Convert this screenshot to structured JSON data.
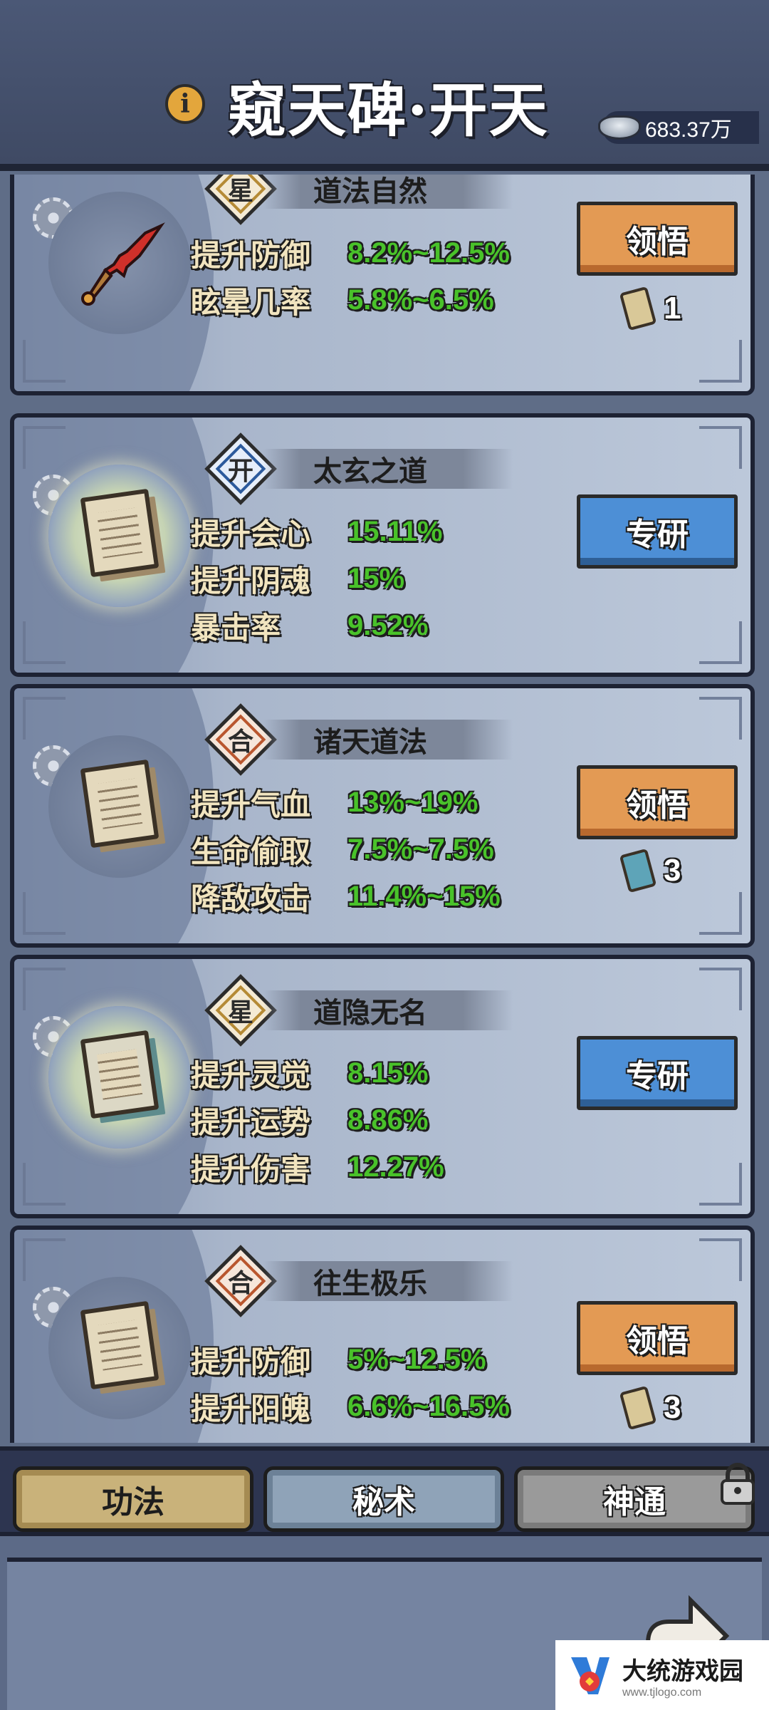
{
  "header": {
    "title": "窥天碑·开天",
    "info_icon": "i",
    "currency_value": "683.37万"
  },
  "skills": [
    {
      "grade": "星",
      "name": "道法自然",
      "icon": "red-sword-icon",
      "stats": [
        {
          "label": "提升防御",
          "value": "8.2%~12.5%"
        },
        {
          "label": "眩晕几率",
          "value": "5.8%~6.5%"
        }
      ],
      "action": "领悟",
      "action_color": "#e39a54",
      "cost_count": "1"
    },
    {
      "grade": "开",
      "name": "太玄之道",
      "icon": "scroll-icon",
      "stats": [
        {
          "label": "提升会心",
          "value": "15.11%"
        },
        {
          "label": "提升阴魂",
          "value": "15%"
        },
        {
          "label": "暴击率",
          "value": "9.52%"
        }
      ],
      "action": "专研",
      "action_color": "#4d8fd6"
    },
    {
      "grade": "合",
      "name": "诸天道法",
      "icon": "scroll-icon",
      "stats": [
        {
          "label": "提升气血",
          "value": "13%~19%"
        },
        {
          "label": "生命偷取",
          "value": "7.5%~7.5%"
        },
        {
          "label": "降敌攻击",
          "value": "11.4%~15%"
        }
      ],
      "action": "领悟",
      "action_color": "#e39a54",
      "cost_count": "3"
    },
    {
      "grade": "星",
      "name": "道隐无名",
      "icon": "scroll-icon",
      "stats": [
        {
          "label": "提升灵觉",
          "value": "8.15%"
        },
        {
          "label": "提升运势",
          "value": "8.86%"
        },
        {
          "label": "提升伤害",
          "value": "12.27%"
        }
      ],
      "action": "专研",
      "action_color": "#4d8fd6"
    },
    {
      "grade": "合",
      "name": "往生极乐",
      "icon": "scroll-icon",
      "stats": [
        {
          "label": "提升防御",
          "value": "5%~12.5%"
        },
        {
          "label": "提升阳魄",
          "value": "6.6%~16.5%"
        }
      ],
      "action": "领悟",
      "action_color": "#e39a54",
      "cost_count": "3"
    }
  ],
  "tabs": [
    {
      "label": "功法",
      "active": true
    },
    {
      "label": "秘术",
      "active": false
    },
    {
      "label": "神通",
      "active": false,
      "locked": true
    }
  ],
  "watermark": {
    "title": "大统游戏园",
    "url": "www.tjlogo.com"
  }
}
